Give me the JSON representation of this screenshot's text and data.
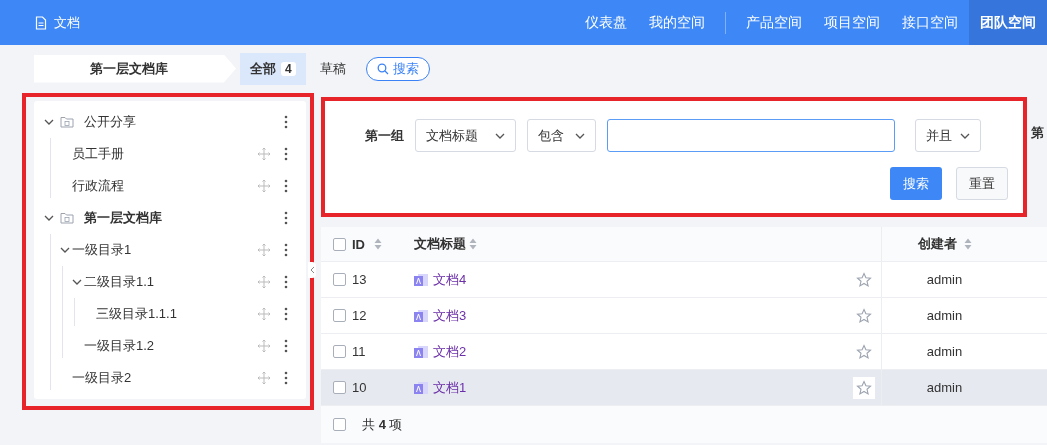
{
  "app": {
    "title": "文档"
  },
  "nav": [
    {
      "label": "仪表盘",
      "selected": false
    },
    {
      "label": "我的空间",
      "selected": false
    },
    {
      "label": "产品空间",
      "selected": false
    },
    {
      "label": "项目空间",
      "selected": false
    },
    {
      "label": "接口空间",
      "selected": false
    },
    {
      "label": "团队空间",
      "selected": true
    }
  ],
  "breadcrumb": "第一层文档库",
  "tabs": [
    {
      "label": "全部",
      "count": "4",
      "selected": true
    },
    {
      "label": "草稿",
      "selected": false
    }
  ],
  "search_button": "搜索",
  "tree": [
    {
      "label": "公开分享",
      "kind": "library",
      "selected": false,
      "expanded": true,
      "children": [
        {
          "label": "员工手册",
          "kind": "doc",
          "selected": false
        },
        {
          "label": "行政流程",
          "kind": "doc",
          "selected": false
        }
      ]
    },
    {
      "label": "第一层文档库",
      "kind": "library",
      "selected": true,
      "expanded": true,
      "children": [
        {
          "label": "一级目录1",
          "kind": "doc",
          "selected": false,
          "expanded": true,
          "children": [
            {
              "label": "二级目录1.1",
              "kind": "doc",
              "selected": false,
              "expanded": true,
              "children": [
                {
                  "label": "三级目录1.1.1",
                  "kind": "doc",
                  "selected": false
                }
              ]
            },
            {
              "label": "一级目录1.2",
              "kind": "doc",
              "selected": false
            }
          ]
        },
        {
          "label": "一级目录2",
          "kind": "doc",
          "selected": false
        }
      ]
    }
  ],
  "filter": {
    "group_label": "第一组",
    "field": "文档标题",
    "operator": "包含",
    "logic": "并且",
    "next_group_label": "第",
    "search": "搜索",
    "reset": "重置"
  },
  "table": {
    "header_checked": false,
    "columns": [
      "ID",
      "文档标题",
      "创建者"
    ],
    "rows": [
      {
        "id": "13",
        "title": "文档4",
        "creator": "admin",
        "checked": false,
        "starred": false,
        "hovered": false
      },
      {
        "id": "12",
        "title": "文档3",
        "creator": "admin",
        "checked": false,
        "starred": false,
        "hovered": false
      },
      {
        "id": "11",
        "title": "文档2",
        "creator": "admin",
        "checked": false,
        "starred": false,
        "hovered": false
      },
      {
        "id": "10",
        "title": "文档1",
        "creator": "admin",
        "checked": false,
        "starred": false,
        "hovered": true
      }
    ],
    "footer": "共 **4** 项",
    "footer_checked": false
  }
}
